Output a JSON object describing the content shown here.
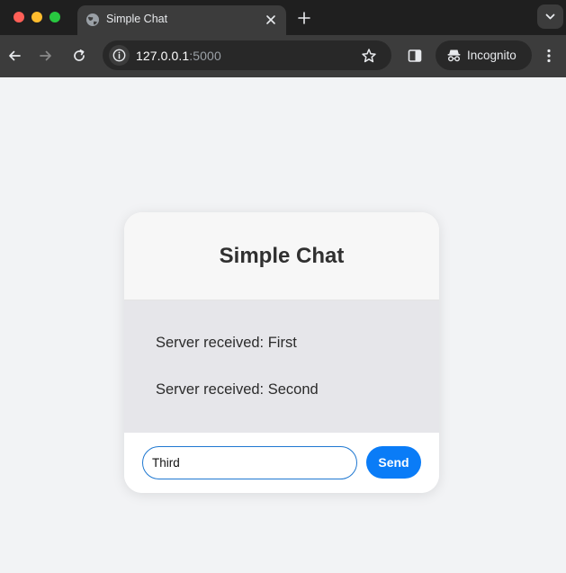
{
  "browser": {
    "tab": {
      "title": "Simple Chat",
      "favicon": "globe-icon"
    },
    "address": {
      "host": "127.0.0.1",
      "port": ":5000"
    },
    "profile": {
      "label": "Incognito"
    },
    "icons": {
      "back": "arrow-left-icon",
      "forward": "arrow-right-icon",
      "reload": "reload-icon",
      "site_info": "info-icon",
      "bookmark": "star-icon",
      "side_panel": "side-panel-icon",
      "menu": "kebab-menu-icon",
      "new_tab": "plus-icon",
      "tab_search": "chevron-down-icon",
      "tab_close": "close-icon"
    }
  },
  "chat": {
    "title": "Simple Chat",
    "messages": [
      {
        "text": "Server received: First"
      },
      {
        "text": "Server received: Second"
      }
    ],
    "input": {
      "value": "Third"
    },
    "send_label": "Send"
  },
  "colors": {
    "accent": "#0a7cf7",
    "page_background": "#f2f3f5",
    "messages_background": "#e6e6ea"
  }
}
